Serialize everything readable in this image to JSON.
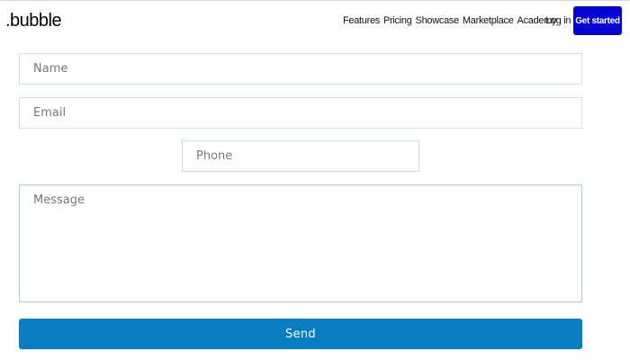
{
  "header": {
    "logo_text": ".bubble",
    "nav": [
      {
        "label": "Features"
      },
      {
        "label": "Pricing"
      },
      {
        "label": "Showcase"
      },
      {
        "label": "Marketplace"
      },
      {
        "label": "Academy"
      }
    ],
    "login_label": "Log in",
    "cta_label": "Get started",
    "cta_color": "#0205d3"
  },
  "form": {
    "name": {
      "placeholder": "Name",
      "value": ""
    },
    "email": {
      "placeholder": "Email",
      "value": ""
    },
    "phone": {
      "placeholder": "Phone",
      "value": ""
    },
    "message": {
      "placeholder": "Message",
      "value": ""
    },
    "send_label": "Send",
    "send_color": "#0a7ec2"
  }
}
